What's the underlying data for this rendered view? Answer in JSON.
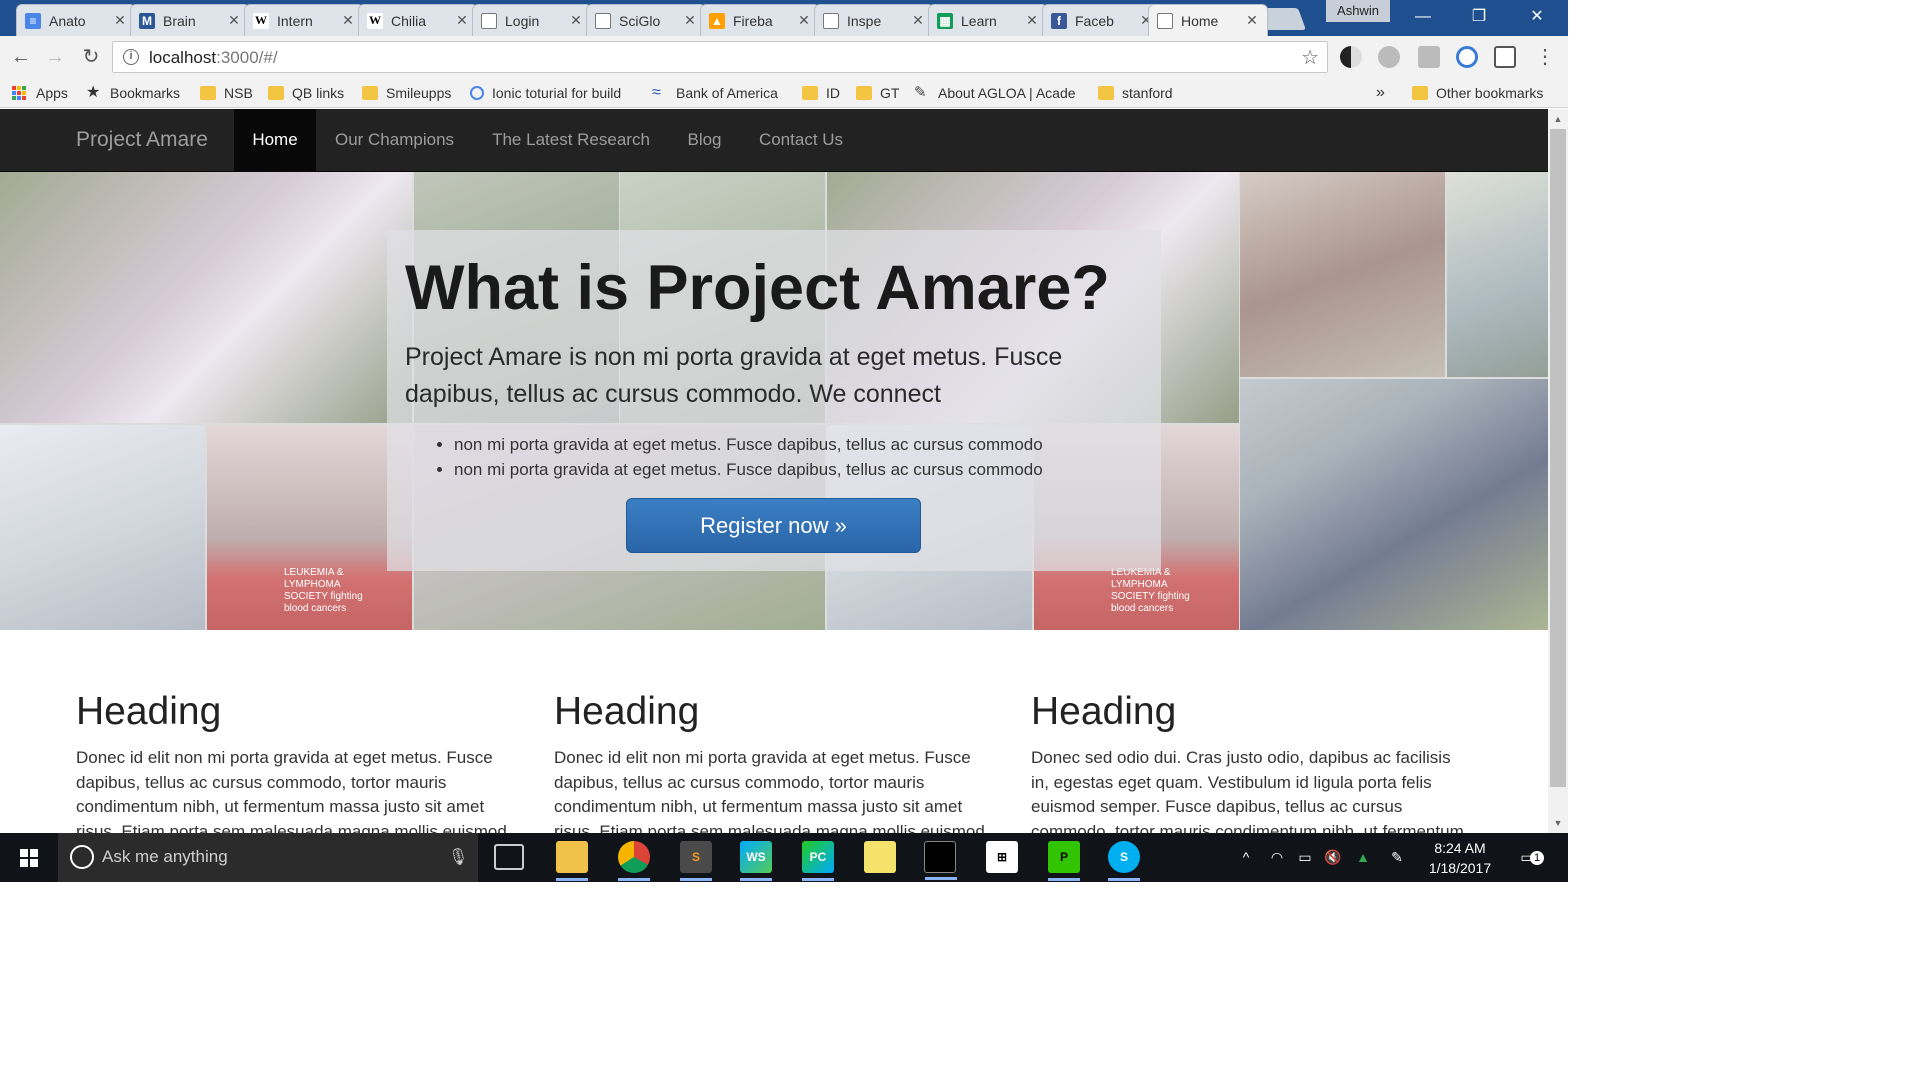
{
  "browser": {
    "tabs": [
      {
        "title": "Anato",
        "icon": "docs-icon"
      },
      {
        "title": "Brain",
        "icon": "m-icon"
      },
      {
        "title": "Intern",
        "icon": "wikipedia-icon"
      },
      {
        "title": "Chilia",
        "icon": "wikipedia-icon"
      },
      {
        "title": "Login",
        "icon": "page-icon"
      },
      {
        "title": "SciGlo",
        "icon": "page-icon"
      },
      {
        "title": "Fireba",
        "icon": "firebase-icon"
      },
      {
        "title": "Inspe",
        "icon": "page-icon"
      },
      {
        "title": "Learn",
        "icon": "sheets-icon"
      },
      {
        "title": "Faceb",
        "icon": "facebook-icon"
      },
      {
        "title": "Home",
        "icon": "page-icon"
      }
    ],
    "profile_name": "Ashwin",
    "url_host": "localhost",
    "url_path": ":3000/#/",
    "bookmarks": {
      "apps_label": "Apps",
      "items": [
        {
          "label": "Bookmarks"
        },
        {
          "label": "NSB"
        },
        {
          "label": "QB links"
        },
        {
          "label": "Smileupps"
        },
        {
          "label": "Ionic toturial for build"
        },
        {
          "label": "Bank of America"
        },
        {
          "label": "ID"
        },
        {
          "label": "GT"
        },
        {
          "label": "About AGLOA | Acade"
        },
        {
          "label": "stanford"
        }
      ],
      "overflow": "»",
      "other": "Other bookmarks"
    }
  },
  "site": {
    "brand": "Project Amare",
    "nav": [
      {
        "label": "Home",
        "active": true
      },
      {
        "label": "Our Champions"
      },
      {
        "label": "The Latest Research"
      },
      {
        "label": "Blog"
      },
      {
        "label": "Contact Us"
      }
    ],
    "hero": {
      "title": "What is Project Amare?",
      "lead": "Project Amare is non mi porta gravida at eget metus. Fusce dapibus, tellus ac cursus commodo. We connect",
      "bullets": [
        "non mi porta gravida at eget metus. Fusce dapibus, tellus ac cursus commodo",
        "non mi porta gravida at eget metus. Fusce dapibus, tellus ac cursus commodo"
      ],
      "cta": "Register now »",
      "banner_text": "LEUKEMIA & LYMPHOMA SOCIETY fighting blood cancers"
    },
    "columns": [
      {
        "heading": "Heading",
        "text": "Donec id elit non mi porta gravida at eget metus. Fusce dapibus, tellus ac cursus commodo, tortor mauris condimentum nibh, ut fermentum massa justo sit amet risus. Etiam porta sem malesuada magna mollis euismod."
      },
      {
        "heading": "Heading",
        "text": "Donec id elit non mi porta gravida at eget metus. Fusce dapibus, tellus ac cursus commodo, tortor mauris condimentum nibh, ut fermentum massa justo sit amet risus. Etiam porta sem malesuada magna mollis euismod."
      },
      {
        "heading": "Heading",
        "text": "Donec sed odio dui. Cras justo odio, dapibus ac facilisis in, egestas eget quam. Vestibulum id ligula porta felis euismod semper. Fusce dapibus, tellus ac cursus commodo, tortor mauris condimentum nibh, ut fermentum"
      }
    ]
  },
  "taskbar": {
    "search_placeholder": "Ask me anything",
    "time": "8:24 AM",
    "date": "1/18/2017",
    "notification_count": "1",
    "apps": [
      {
        "name": "task-view-icon"
      },
      {
        "name": "file-explorer-icon"
      },
      {
        "name": "chrome-icon"
      },
      {
        "name": "sublime-text-icon",
        "label": "S"
      },
      {
        "name": "webstorm-icon",
        "label": "WS"
      },
      {
        "name": "pycharm-icon",
        "label": "PC"
      },
      {
        "name": "sticky-notes-icon"
      },
      {
        "name": "terminal-icon"
      },
      {
        "name": "store-icon"
      },
      {
        "name": "pycharm-edu-icon",
        "label": "P"
      },
      {
        "name": "skype-icon",
        "label": "S"
      }
    ]
  },
  "colors": {
    "navbar_bg": "#222222",
    "navbar_active": "#080808",
    "cta_blue": "#2f6fb5",
    "tabstrip": "#1f4f8f"
  }
}
